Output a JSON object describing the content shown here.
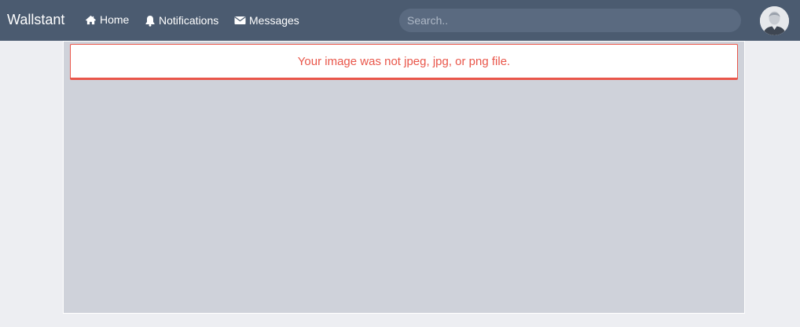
{
  "brand": {
    "name": "Wallstant"
  },
  "nav": {
    "items": [
      {
        "label": "Home",
        "icon": "home-icon"
      },
      {
        "label": "Notifications",
        "icon": "bell-icon"
      },
      {
        "label": "Messages",
        "icon": "envelope-icon"
      }
    ]
  },
  "search": {
    "placeholder": "Search..",
    "value": ""
  },
  "alert": {
    "message": "Your image was not jpeg, jpg, or png file.",
    "color": "#e9564a"
  },
  "colors": {
    "navbar": "#4b5b70",
    "page_bg": "#edeef2",
    "panel_bg": "#cfd2da"
  }
}
